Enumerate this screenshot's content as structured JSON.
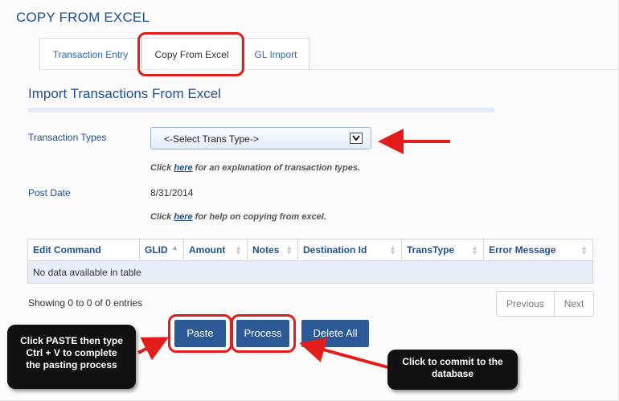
{
  "page": {
    "title": "COPY FROM EXCEL"
  },
  "tabs": [
    {
      "label": "Transaction Entry"
    },
    {
      "label": "Copy From Excel"
    },
    {
      "label": "GL Import"
    }
  ],
  "section": {
    "title": "Import Transactions From Excel"
  },
  "form": {
    "trans_type_label": "Transaction Types",
    "trans_type_selected": "<-Select Trans Type->",
    "hint1_prefix": "Click ",
    "hint1_link": "here",
    "hint1_suffix": " for an explanation of transaction types.",
    "post_date_label": "Post Date",
    "post_date_value": "8/31/2014",
    "hint2_prefix": "Click ",
    "hint2_link": "here",
    "hint2_suffix": " for help on copying from excel."
  },
  "table": {
    "columns": [
      "Edit Command",
      "GLID",
      "Amount",
      "Notes",
      "Destination Id",
      "TransType",
      "Error Message"
    ],
    "empty_message": "No data available in table"
  },
  "pagination": {
    "info": "Showing 0 to 0 of 0 entries",
    "previous": "Previous",
    "next": "Next"
  },
  "buttons": {
    "paste": "Paste",
    "process": "Process",
    "delete_all": "Delete All"
  },
  "annotations": {
    "paste_callout": [
      "Click PASTE then type",
      "Ctrl + V to complete",
      "the pasting process"
    ],
    "process_callout": [
      "Click to commit to the",
      "database"
    ],
    "highlight_color": "#e31c1c"
  }
}
